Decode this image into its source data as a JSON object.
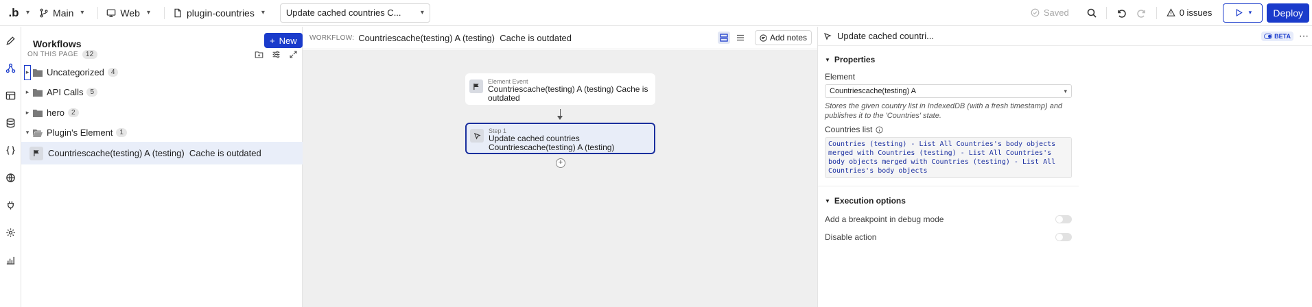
{
  "topbar": {
    "logo": ".b",
    "branch": "Main",
    "platform": "Web",
    "app_name": "plugin-countries",
    "workflow_select": "Update cached countries C...",
    "saved_label": "Saved",
    "issues_label": "0 issues",
    "deploy_label": "Deploy"
  },
  "rail": {
    "icons": [
      "pencil-icon",
      "workflow-icon",
      "layout-icon",
      "database-icon",
      "code-braces-icon",
      "globe-icon",
      "plug-icon",
      "gear-icon",
      "chart-icon"
    ]
  },
  "workflows_panel": {
    "title": "Workflows",
    "new_label": "New",
    "on_this_page": "ON THIS PAGE",
    "page_count": "12",
    "folders": [
      {
        "label": "Uncategorized",
        "count": "4",
        "open": false
      },
      {
        "label": "API Calls",
        "count": "5",
        "open": false
      },
      {
        "label": "hero",
        "count": "2",
        "open": false
      },
      {
        "label": "Plugin's Element",
        "count": "1",
        "open": true
      }
    ],
    "selected_item": "Countriescache(testing) A (testing)  Cache is outdated"
  },
  "canvas": {
    "workflow_label": "WORKFLOW:",
    "workflow_name": "Countriescache(testing) A (testing)  Cache is outdated",
    "add_notes": "Add notes",
    "event_card": {
      "kicker": "Element Event",
      "title": "Countriescache(testing) A (testing) Cache is outdated"
    },
    "step_card": {
      "kicker": "Step 1",
      "title": "Update cached countries Countriescache(testing) A (testing)"
    },
    "plus": "+"
  },
  "properties": {
    "header_title": "Update cached countri...",
    "beta": "BETA",
    "section_properties": "Properties",
    "element_label": "Element",
    "element_value": "Countriescache(testing) A",
    "help_text": "Stores the given country list in IndexedDB (with a fresh timestamp) and publishes it to the 'Countries' state.",
    "countries_list_label": "Countries list",
    "countries_list_value": "Countries (testing) - List All Countries's body objects merged with Countries (testing) - List All Countries's body objects merged with Countries (testing) - List All Countries's body objects",
    "section_execution": "Execution options",
    "breakpoint_label": "Add a breakpoint in debug mode",
    "disable_label": "Disable action"
  },
  "colors": {
    "accent": "#1a3bcb",
    "selected_row": "#e9eef9",
    "canvas_bg": "#efefef"
  }
}
